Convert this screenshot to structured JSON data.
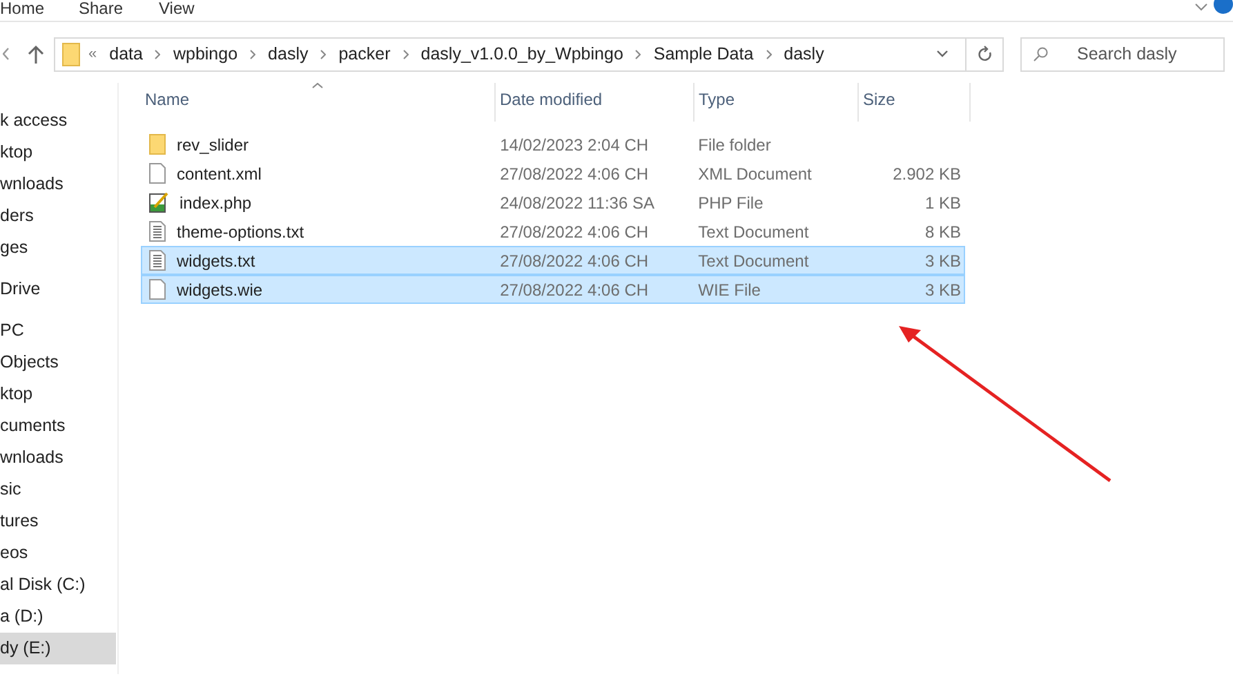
{
  "ribbon_tabs": [
    "Home",
    "Share",
    "View"
  ],
  "address": {
    "overflow": "«",
    "crumbs": [
      "data",
      "wpbingo",
      "dasly",
      "packer",
      "dasly_v1.0.0_by_Wpbingo",
      "Sample Data",
      "dasly"
    ]
  },
  "search": {
    "placeholder": "Search dasly"
  },
  "sidebar": {
    "groups": [
      [
        {
          "label": "k access",
          "selected": false
        },
        {
          "label": "ktop",
          "selected": false
        },
        {
          "label": "wnloads",
          "selected": false
        },
        {
          "label": "ders",
          "selected": false
        },
        {
          "label": "ges",
          "selected": false
        }
      ],
      [
        {
          "label": "Drive",
          "selected": false
        }
      ],
      [
        {
          "label": "PC",
          "selected": false
        },
        {
          "label": "Objects",
          "selected": false
        },
        {
          "label": "ktop",
          "selected": false
        },
        {
          "label": "cuments",
          "selected": false
        },
        {
          "label": "wnloads",
          "selected": false
        },
        {
          "label": "sic",
          "selected": false
        },
        {
          "label": "tures",
          "selected": false
        },
        {
          "label": "eos",
          "selected": false
        },
        {
          "label": "al Disk (C:)",
          "selected": false
        },
        {
          "label": "a (D:)",
          "selected": false
        },
        {
          "label": "dy (E:)",
          "selected": true
        }
      ]
    ]
  },
  "table": {
    "columns": [
      "Name",
      "Date modified",
      "Type",
      "Size"
    ],
    "rows": [
      {
        "kind": "folder",
        "name": "rev_slider",
        "date": "14/02/2023 2:04 CH",
        "type": "File folder",
        "selected": false
      },
      {
        "kind": "blank",
        "name": "content.xml",
        "date": "27/08/2022 4:06 CH",
        "type": "XML Document",
        "size": "2.902 KB",
        "selected": false
      },
      {
        "kind": "php",
        "name": "index.php",
        "date": "24/08/2022 11:36 SA",
        "type": "PHP File",
        "size": "1 KB",
        "selected": false
      },
      {
        "kind": "text",
        "name": "theme-options.txt",
        "date": "27/08/2022 4:06 CH",
        "type": "Text Document",
        "size": "8 KB",
        "selected": false
      },
      {
        "kind": "text",
        "name": "widgets.txt",
        "date": "27/08/2022 4:06 CH",
        "type": "Text Document",
        "size": "3 KB",
        "selected": true
      },
      {
        "kind": "blank",
        "name": "widgets.wie",
        "date": "27/08/2022 4:06 CH",
        "type": "WIE File",
        "size": "3 KB",
        "selected": true
      }
    ]
  }
}
